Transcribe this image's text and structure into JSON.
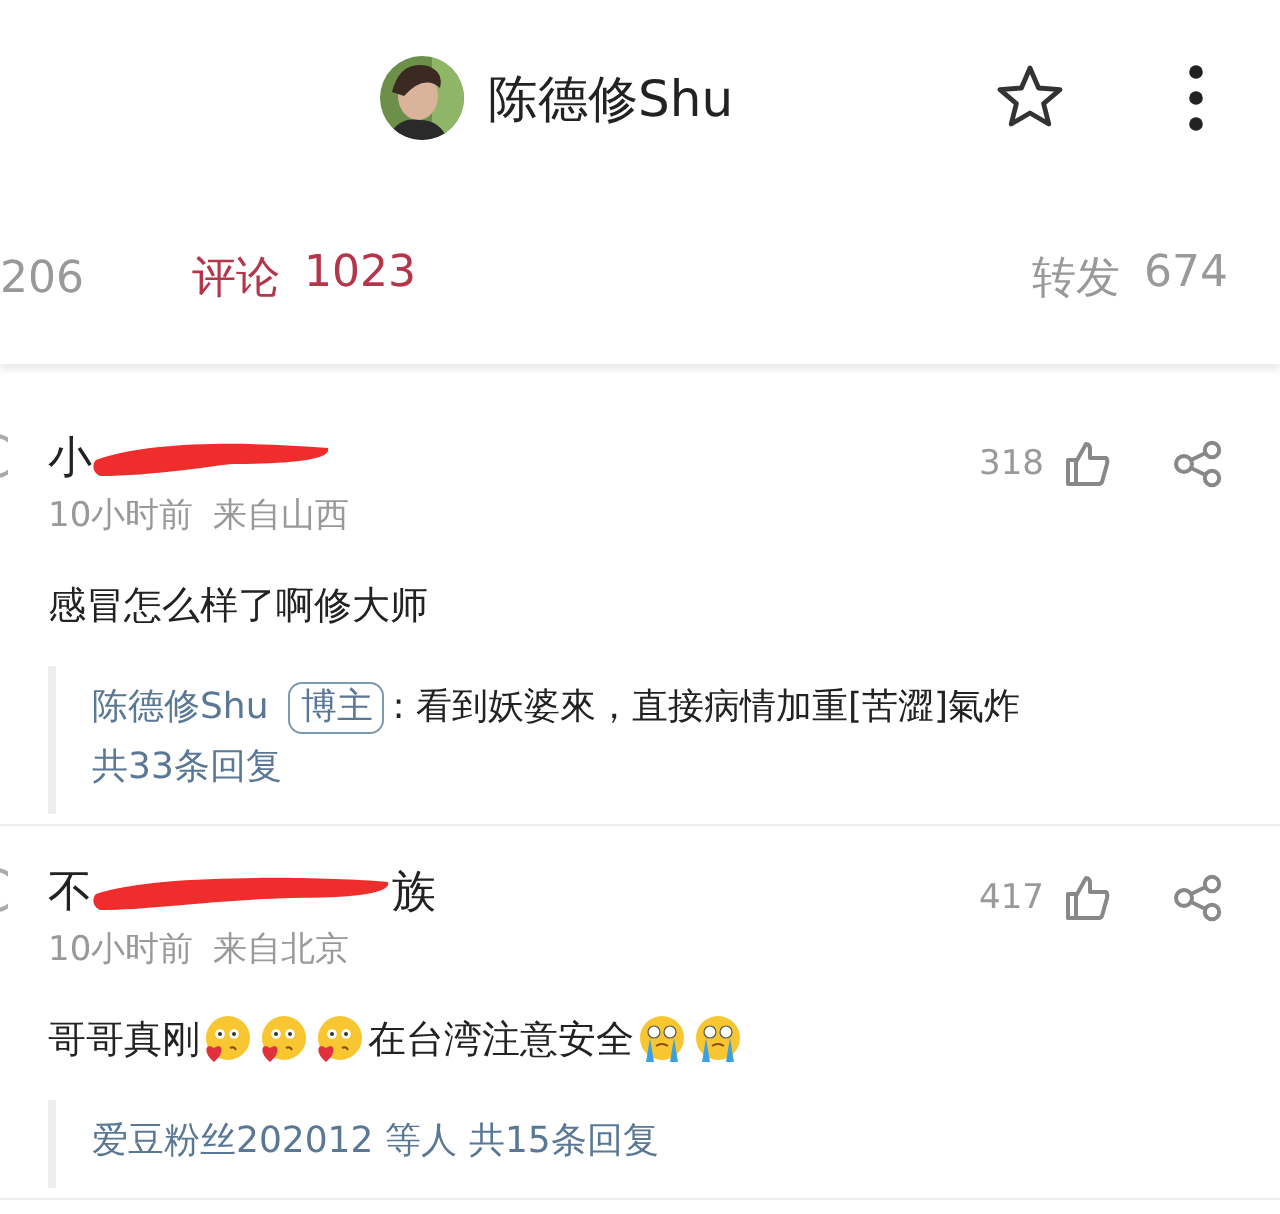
{
  "header": {
    "title": "陈德修Shu"
  },
  "tabs": [
    {
      "count": "206",
      "selected": false
    },
    {
      "label": "评论",
      "count": "1023",
      "selected": true
    },
    {
      "label": "转发",
      "count": "674",
      "selected": false
    }
  ],
  "comments": [
    {
      "name_start": "小",
      "time": "10小时前",
      "source": "来自山西",
      "likes": "318",
      "content": [
        {
          "kind": "text",
          "text": "感冒怎么样了啊修大师"
        }
      ],
      "reply": {
        "kind": "author",
        "author": "陈德修Shu",
        "badge": "博主",
        "text": ": 看到妖婆來，直接病情加重[苦澀]氣炸",
        "more": "共33条回复"
      }
    },
    {
      "name_start": "不",
      "name_end": "族",
      "time": "10小时前",
      "source": "来自北京",
      "likes": "417",
      "content": [
        {
          "kind": "text",
          "text": "哥哥真刚"
        },
        {
          "kind": "kiss"
        },
        {
          "kind": "kiss"
        },
        {
          "kind": "kiss"
        },
        {
          "kind": "text",
          "text": "在台湾注意安全"
        },
        {
          "kind": "cry"
        },
        {
          "kind": "cry"
        }
      ],
      "reply": {
        "kind": "summary",
        "author": "爱豆粉丝202012 等人",
        "more": "共15条回复"
      }
    }
  ]
}
